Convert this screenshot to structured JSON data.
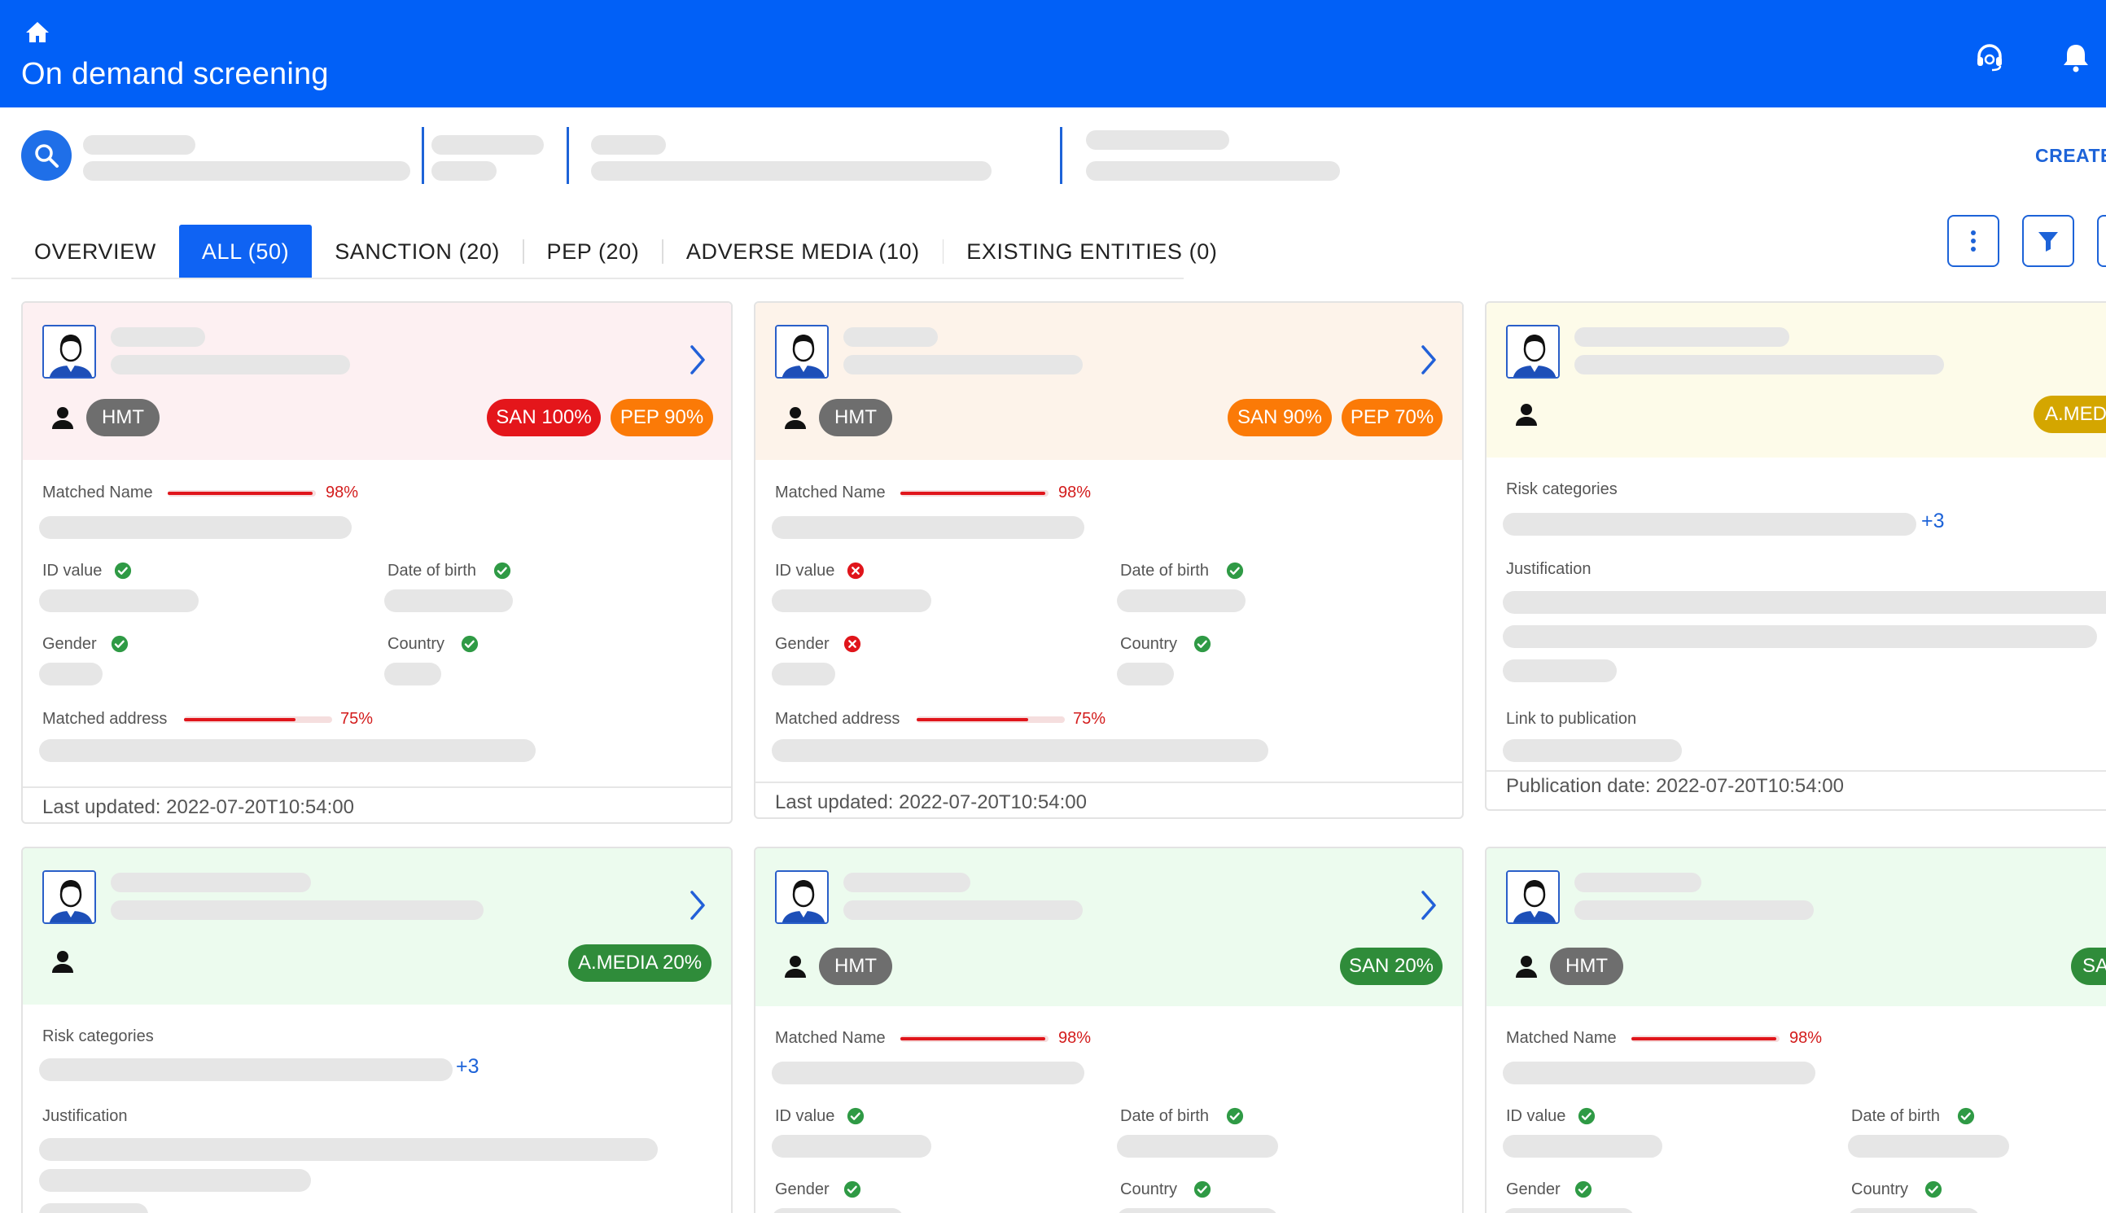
{
  "app": {
    "title": "On demand screening",
    "create_label": "CREATE"
  },
  "tabs": [
    {
      "label": "OVERVIEW"
    },
    {
      "label": "ALL (50)"
    },
    {
      "label": "SANCTION (20)"
    },
    {
      "label": "PEP (20)"
    },
    {
      "label": "ADVERSE MEDIA (10)"
    },
    {
      "label": "EXISTING ENTITIES (0)"
    }
  ],
  "colors": {
    "header": "#0160f7",
    "accent": "#1d63d8",
    "san_red": "#e4161b",
    "pep_orange": "#fb7a07",
    "media_green": "#2f8c3a",
    "media_yellow": "#d4a600",
    "card1_bg": "#fdf0f2",
    "card2_bg": "#fdf3ea",
    "card3_bg": "#fdfbe9",
    "green_bg": "#ecfbee"
  },
  "cards": [
    {
      "tag": "HMT",
      "badge1": "SAN 100%",
      "badge2": "PEP 90%",
      "matched_name_label": "Matched Name",
      "matched_name_pct": "98%",
      "matched_name_value": 0.98,
      "id_label": "ID value",
      "dob_label": "Date of birth",
      "gender_label": "Gender",
      "country_label": "Country",
      "address_label": "Matched address",
      "address_pct": "75%",
      "address_value": 0.75,
      "footer": "Last updated: 2022-07-20T10:54:00"
    },
    {
      "tag": "HMT",
      "badge1": "SAN 90%",
      "badge2": "PEP 70%",
      "matched_name_label": "Matched Name",
      "matched_name_pct": "98%",
      "matched_name_value": 0.98,
      "id_label": "ID value",
      "dob_label": "Date of birth",
      "gender_label": "Gender",
      "country_label": "Country",
      "address_label": "Matched address",
      "address_pct": "75%",
      "address_value": 0.75,
      "footer": "Last updated: 2022-07-20T10:54:00"
    },
    {
      "badge1": "A.MEDI",
      "risk_label": "Risk categories",
      "risk_more": "+3",
      "justification_label": "Justification",
      "link_label": "Link to publication",
      "footer": "Publication date: 2022-07-20T10:54:00"
    },
    {
      "badge1": "A.MEDIA 20%",
      "risk_label": "Risk categories",
      "risk_more": "+3",
      "justification_label": "Justification"
    },
    {
      "tag": "HMT",
      "badge1": "SAN 20%",
      "matched_name_label": "Matched Name",
      "matched_name_pct": "98%",
      "matched_name_value": 0.98,
      "id_label": "ID value",
      "dob_label": "Date of birth",
      "gender_label": "Gender",
      "country_label": "Country"
    },
    {
      "tag": "HMT",
      "badge1": "SA",
      "matched_name_label": "Matched Name",
      "matched_name_pct": "98%",
      "matched_name_value": 0.98,
      "id_label": "ID value",
      "dob_label": "Date of birth",
      "gender_label": "Gender",
      "country_label": "Country"
    }
  ],
  "icons": {
    "home": "home-icon",
    "support": "headset-icon",
    "notifications": "bell-icon",
    "search": "search-icon",
    "more": "more-vertical-icon",
    "filter": "filter-icon",
    "chevron": "chevron-right-icon",
    "person": "person-icon",
    "check": "check-circle-icon",
    "cross": "x-circle-icon"
  }
}
